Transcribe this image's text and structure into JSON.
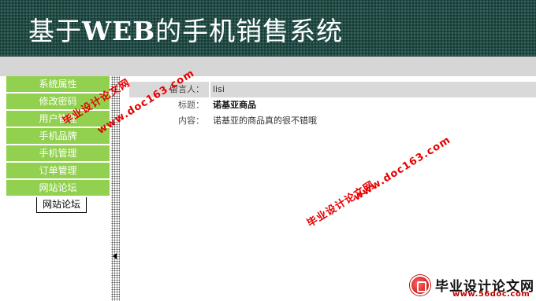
{
  "banner": {
    "title_pre": "基于",
    "title_bold": "WEB",
    "title_post": "的手机销售系统"
  },
  "sidebar": {
    "items": [
      {
        "label": "系统属性"
      },
      {
        "label": "修改密码"
      },
      {
        "label": "用户管理"
      },
      {
        "label": "手机品牌"
      },
      {
        "label": "手机管理"
      },
      {
        "label": "订单管理"
      },
      {
        "label": "网站论坛"
      }
    ],
    "current": "网站论坛"
  },
  "message": {
    "author_label": "留言人：",
    "author_value": "lisi",
    "title_label": "标题：",
    "title_value": "诺基亚商品",
    "content_label": "内容：",
    "content_value": "诺基亚的商品真的很不错哦"
  },
  "watermark": {
    "cn": "毕业设计论文网",
    "url": "www.doc163.com"
  },
  "logo": {
    "title": "毕业设计论文网",
    "url": "www.56doc.com"
  },
  "colors": {
    "banner_bg": "#1f4a44",
    "menu_green": "#92d14f",
    "watermark_red": "#e60000"
  }
}
